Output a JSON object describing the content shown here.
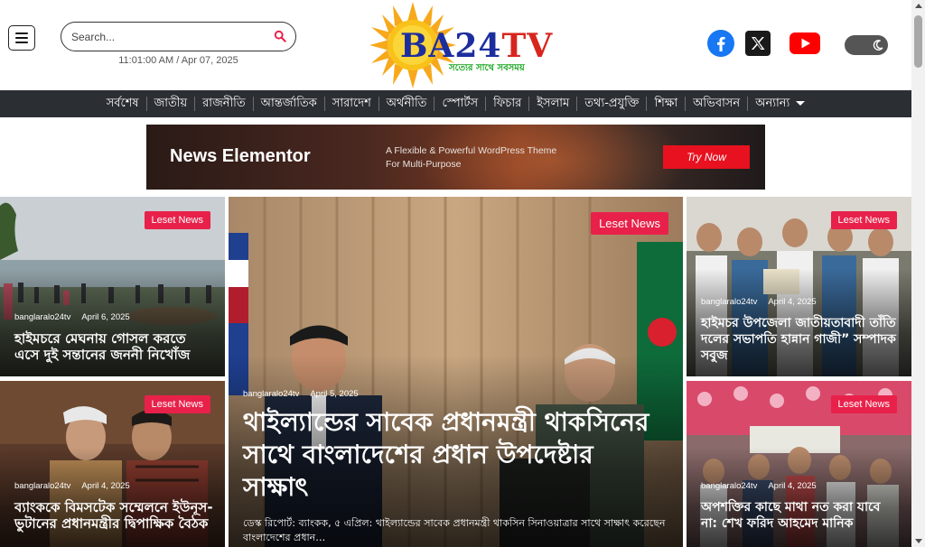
{
  "header": {
    "search_placeholder": "Search...",
    "datetime": "11:01:00 AM / Apr 07, 2025",
    "logo": {
      "brand_part1": "BA24",
      "brand_part2": "TV",
      "tagline": "সত্যের সাথে সবসময়"
    }
  },
  "nav": {
    "items": [
      "সর্বশেষ",
      "জাতীয়",
      "রাজনীতি",
      "আন্তর্জাতিক",
      "সারাদেশ",
      "অর্থনীতি",
      "স্পোর্টস",
      "ফিচার",
      "ইসলাম",
      "তথ্য-প্রযুক্তি",
      "শিক্ষা",
      "অভিবাসন",
      "অন্যান্য"
    ]
  },
  "banner": {
    "title": "News Elementor",
    "subtitle": "A Flexible & Powerful WordPress Theme For Multi-Purpose",
    "button": "Try Now"
  },
  "posts": {
    "left_top": {
      "badge": "Leset News",
      "author": "banglaralo24tv",
      "date": "April 6, 2025",
      "title": "হাইমচরে মেঘনায় গোসল করতে এসে দুই সন্তানের জননী নিখোঁজ"
    },
    "left_bottom": {
      "badge": "Leset News",
      "author": "banglaralo24tv",
      "date": "April 4, 2025",
      "title": "ব্যাংককে বিমসটেক সম্মেলনে ইউনূস-ভুটানের প্রধানমন্ত্রীর দ্বিপাক্ষিক বৈঠক"
    },
    "hero": {
      "badge": "Leset News",
      "author": "banglaralo24tv",
      "date": "April 5, 2025",
      "title": "থাইল্যান্ডের সাবেক প্রধানমন্ত্রী থাকসিনের সাথে বাংলাদেশের প্রধান উপদেষ্টার সাক্ষাৎ",
      "excerpt": "ডেস্ক রিপোর্ট: ব্যাংকক, ৫ এপ্রিল: থাইল্যান্ডের সাবেক প্রধানমন্ত্রী থাকসিন সিনাওয়াত্রার সাথে সাক্ষাৎ করেছেন বাংলাদেশের প্রধান…"
    },
    "right_top": {
      "badge": "Leset News",
      "author": "banglaralo24tv",
      "date": "April 4, 2025",
      "title": "হাইমচর উপজেলা জাতীয়তাবাদী তাঁতি দলের সভাপতি হান্নান গাজী” সম্পাদক সবুজ"
    },
    "right_bottom": {
      "badge": "Leset News",
      "author": "banglaralo24tv",
      "date": "April 4, 2025",
      "title": "অপশক্তির কাছে মাথা নত করা যাবে না: শেখ ফরিদ আহমেদ মানিক"
    }
  },
  "colors": {
    "nav_bg": "#2b2e33",
    "badge": "#e8214a",
    "logo_blue": "#1c2e9e",
    "logo_red": "#d7261e",
    "tagline_green": "#18a51f",
    "banner_button": "#e8111f"
  }
}
